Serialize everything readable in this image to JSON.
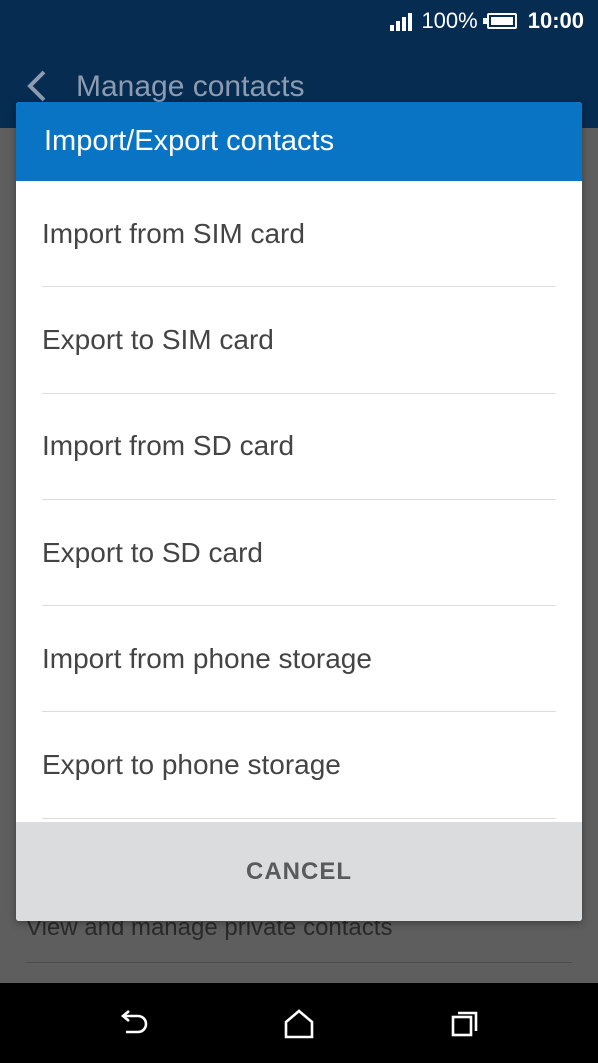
{
  "status_bar": {
    "battery_percent": "100%",
    "time": "10:00",
    "signal_icon": "signal-bars-icon",
    "battery_icon": "battery-icon"
  },
  "app_bar": {
    "title": "Manage contacts",
    "back_icon": "back-arrow-icon"
  },
  "background_list": {
    "visible_item": "View and manage private contacts"
  },
  "dialog": {
    "title": "Import/Export contacts",
    "options": [
      "Import from SIM card",
      "Export to SIM card",
      "Import from SD card",
      "Export to SD card",
      "Import from phone storage",
      "Export to phone storage"
    ],
    "cancel_label": "CANCEL"
  },
  "nav_bar": {
    "back_icon": "back-icon",
    "home_icon": "home-icon",
    "recents_icon": "recents-icon"
  },
  "colors": {
    "header": "#0a74c4",
    "app_bar": "#062c52",
    "cancel_bar": "#dadcde"
  }
}
